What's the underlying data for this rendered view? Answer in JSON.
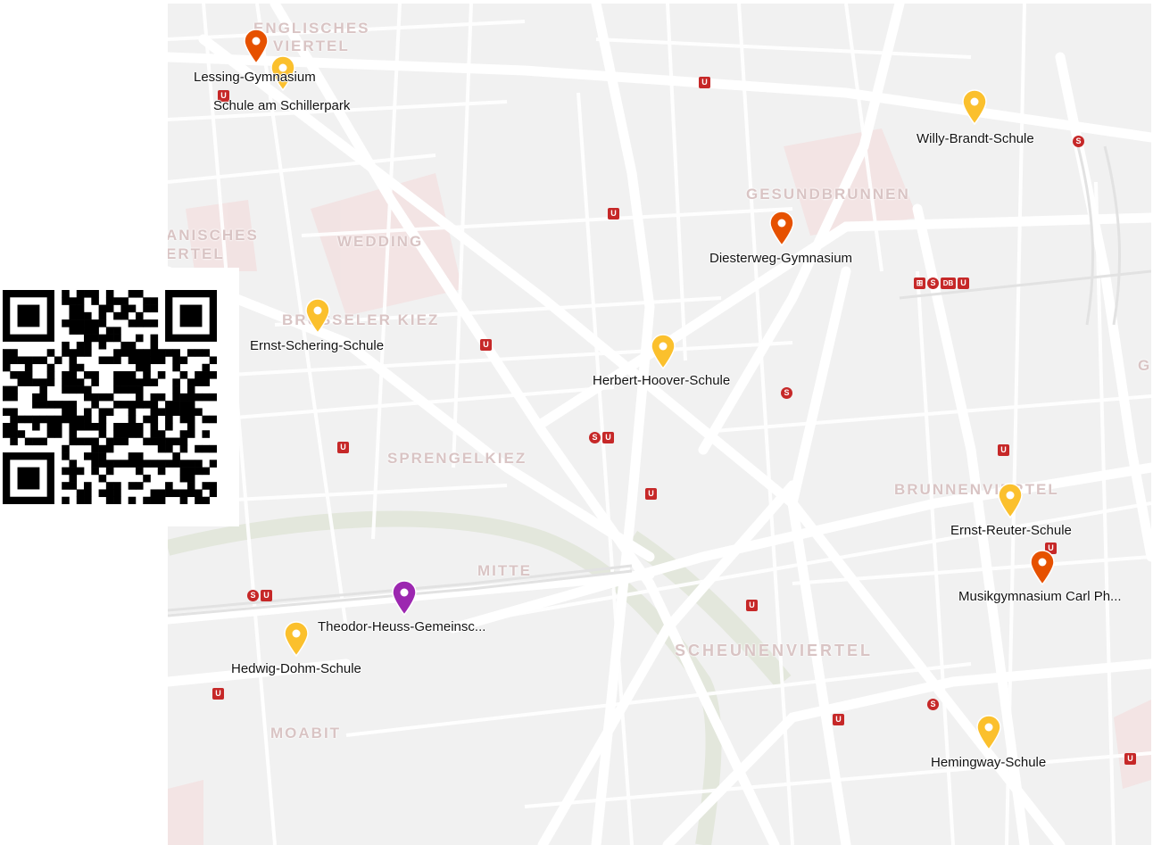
{
  "map": {
    "districts": [
      {
        "text": "ENGLISCHES",
        "cls": "d-englisch1"
      },
      {
        "text": "VIERTEL",
        "cls": "d-englisch2"
      },
      {
        "text": "ANISCHES",
        "cls": "d-anisches1"
      },
      {
        "text": "ERTEL",
        "cls": "d-anisches2"
      },
      {
        "text": "WEDDING",
        "cls": "d-wedding"
      },
      {
        "text": "GESUNDBRUNNEN",
        "cls": "d-gesund"
      },
      {
        "text": "BRÜSSELER KIEZ",
        "cls": "d-bruessel"
      },
      {
        "text": "SPRENGELKIEZ",
        "cls": "d-sprengel"
      },
      {
        "text": "BRUNNENVIERTEL",
        "cls": "d-brunnen"
      },
      {
        "text": "MITTE",
        "cls": "d-mitte"
      },
      {
        "text": "SCHEUNENVIERTEL",
        "cls": "d-scheunen"
      },
      {
        "text": "MOABIT",
        "cls": "d-moabit"
      },
      {
        "text": "G",
        "cls": "d-g"
      }
    ],
    "markers": [
      {
        "name": "Lessing-Gymnasium",
        "color": "#e65100"
      },
      {
        "name": "Schule am Schillerpark",
        "color": "#fbc02d"
      },
      {
        "name": "Willy-Brandt-Schule",
        "color": "#fbc02d"
      },
      {
        "name": "Diesterweg-Gymnasium",
        "color": "#e65100"
      },
      {
        "name": "Ernst-Schering-Schule",
        "color": "#fbc02d"
      },
      {
        "name": "Herbert-Hoover-Schule",
        "color": "#fbc02d"
      },
      {
        "name": "Ernst-Reuter-Schule",
        "color": "#fbc02d"
      },
      {
        "name": "Musikgymnasium Carl Ph...",
        "color": "#e65100"
      },
      {
        "name": "Theodor-Heuss-Gemeinsc...",
        "color": "#9c27b0"
      },
      {
        "name": "Hedwig-Dohm-Schule",
        "color": "#fbc02d"
      },
      {
        "name": "Hemingway-Schule",
        "color": "#fbc02d"
      }
    ],
    "transit": {
      "u": "U",
      "s": "S",
      "db": "DB",
      "tram": "⊞"
    },
    "colors": {
      "background": "#f1f1f1",
      "road": "#ffffff",
      "transit_marker": "#c62828",
      "district_label": "#d9c4c4",
      "park": "#e5e8df"
    }
  },
  "qr": {
    "icon": "qr-code-icon"
  }
}
